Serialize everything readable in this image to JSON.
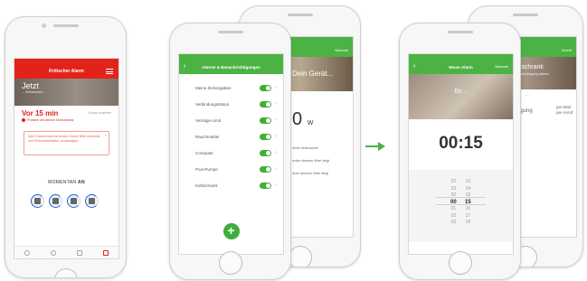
{
  "phone1": {
    "title": "Kritischer Alarm",
    "hero_title": "Jetzt",
    "hero_sub": "... Kühlschrank ...",
    "alert_time": "Vor 15 min",
    "alert_sub": "Problem mit deinem Kühlschrank",
    "alert_right": "Sensor ansehen",
    "message": "Dein Kühlschrank hat keinen Strom! Bitte überprüfe und Elektroinstallation verständigen.",
    "momentan_label": "MOMENTAN",
    "momentan_value": "AN"
  },
  "phone2_back": {
    "action": "Nächste",
    "hero_title": "Dein Gerät...",
    "watt_value": "0",
    "watt_unit": "W",
    "line1": "nicht verbraucht",
    "line2": "unter diesem Wert liegt",
    "line3": "über diesem Wert liegt"
  },
  "phone2_front": {
    "title": "Alarme & Benachrichtigungen",
    "rows": [
      {
        "label": "Meine Zielvorgaben"
      },
      {
        "label": "Verbindungsstatus"
      },
      {
        "label": "Verträge-Limit"
      },
      {
        "label": "Rauchmelder"
      },
      {
        "label": "Computer"
      },
      {
        "label": "Pool-Pumpe"
      },
      {
        "label": "Kühlschrank"
      }
    ],
    "fab_label": "+"
  },
  "phone3_back": {
    "action": "Schritt",
    "hero_title": "...lschrank",
    "hero_sub": "...nachrichtigung wählen",
    "tab1": "...",
    "tab2": "...",
    "label_left": "...igung",
    "label_right1": "per Mail",
    "label_right2": "per Anruf"
  },
  "phone3_front": {
    "title": "Neuer Alarm",
    "action": "Nächste",
    "hero_text": "für...",
    "big_time": "00:15",
    "hours": [
      "22",
      "23",
      "00",
      "01",
      "02",
      "03"
    ],
    "minutes": [
      "13",
      "14",
      "15",
      "16",
      "17",
      "18"
    ],
    "top_hours": [
      "03",
      "02",
      "01"
    ],
    "top_minutes": [
      "16",
      "17",
      "18"
    ]
  },
  "colors": {
    "alarm_red": "#e2231a",
    "brand_green": "#4bb344"
  }
}
